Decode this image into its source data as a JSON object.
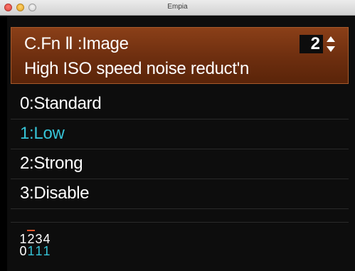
{
  "window": {
    "title": "Empia"
  },
  "header": {
    "line1": "C.Fn Ⅱ :Image",
    "line2": "High ISO speed noise reduct'n",
    "page_number": "2"
  },
  "options": [
    {
      "label": "0:Standard",
      "selected": false
    },
    {
      "label": "1:Low",
      "selected": true
    },
    {
      "label": "2:Strong",
      "selected": false
    },
    {
      "label": "3:Disable",
      "selected": false
    }
  ],
  "settings_summary": {
    "numbers": [
      "1",
      "2",
      "3",
      "4"
    ],
    "values": [
      "0",
      "1",
      "1",
      "1"
    ],
    "current_index": 1
  },
  "colors": {
    "header_bg": "#6d2e0f",
    "selected_text": "#36c3d6",
    "marker": "#e0542a"
  },
  "icons": {
    "page_stepper": "up-down-arrows-icon"
  }
}
